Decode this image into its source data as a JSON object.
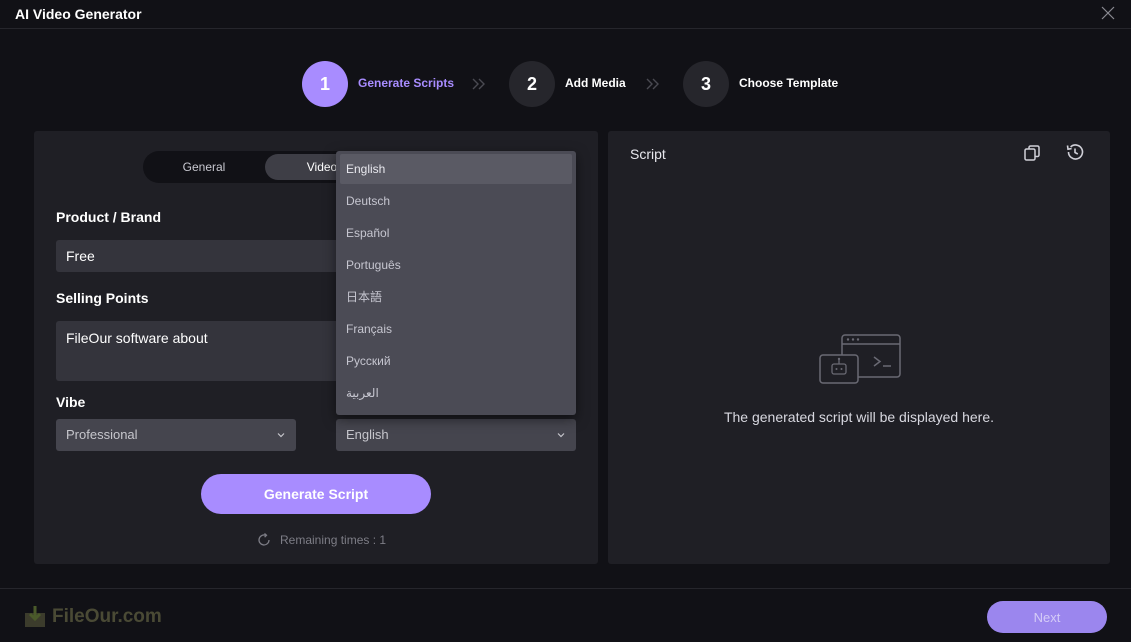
{
  "window": {
    "title": "AI Video Generator"
  },
  "steps": [
    {
      "number": "1",
      "label": "Generate Scripts",
      "active": true
    },
    {
      "number": "2",
      "label": "Add Media",
      "active": false
    },
    {
      "number": "3",
      "label": "Choose Template",
      "active": false
    }
  ],
  "form": {
    "tabs": {
      "general": "General",
      "video": "Video"
    },
    "product_label": "Product / Brand",
    "product_value": "Free",
    "selling_label": "Selling Points",
    "selling_value": "FileOur software about",
    "vibe_label": "Vibe",
    "vibe_value": "Professional",
    "language_value": "English",
    "generate_label": "Generate Script",
    "remaining": "Remaining times : 1"
  },
  "language_dropdown": {
    "options": [
      "English",
      "Deutsch",
      "Español",
      "Português",
      "日本語",
      "Français",
      "Русский",
      "العربية"
    ],
    "selected": "English"
  },
  "script_panel": {
    "label": "Script",
    "empty_message": "The generated script will be displayed here."
  },
  "footer": {
    "watermark": "FileOur.com",
    "next_label": "Next"
  },
  "colors": {
    "accent": "#a88cff",
    "background": "#111116",
    "panel": "#1f1f25"
  }
}
